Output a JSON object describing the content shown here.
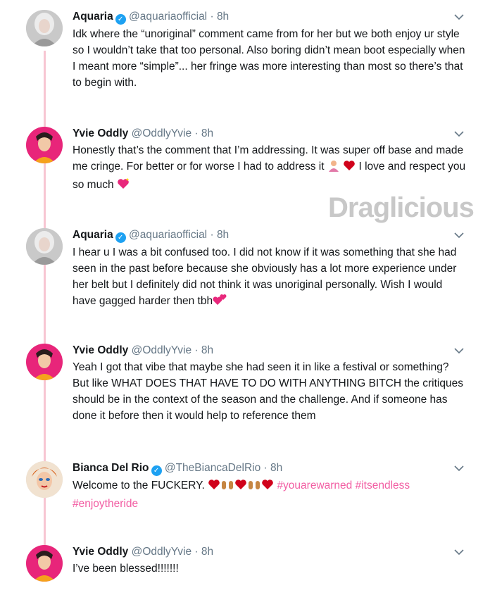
{
  "watermark": "Draglicious",
  "tweets": [
    {
      "name": "Aquaria",
      "verified": true,
      "handle": "@aquariaofficial",
      "time": "8h",
      "text": "Idk where the “unoriginal” comment came from for her but we both enjoy ur style so I wouldn’t take that too personal. Also boring didn’t mean boot especially when I meant more “simple”... her fringe was more interesting than most so there’s that to begin with."
    },
    {
      "name": "Yvie Oddly",
      "verified": false,
      "handle": "@OddlyYvie",
      "time": "8h",
      "text_a": "Honestly that’s the comment that I’m addressing. It was super off base and made me cringe. For better or for worse I had to address it",
      "text_b": "I love and respect you so much",
      "emojis": [
        "person-shrugging-emoji",
        "red-heart-emoji",
        "sparkling-heart-emoji"
      ]
    },
    {
      "name": "Aquaria",
      "verified": true,
      "handle": "@aquariaofficial",
      "time": "8h",
      "text": "I hear u I was a bit confused too. I did not know if it was something that she had seen in the past before because she obviously has a lot more experience under her belt but I definitely did not think it was unoriginal personally. Wish I would have gagged harder then tbh",
      "emojis": [
        "two-hearts-emoji"
      ]
    },
    {
      "name": "Yvie Oddly",
      "verified": false,
      "handle": "@OddlyYvie",
      "time": "8h",
      "text": "Yeah I got that vibe that maybe she had seen it in like a festival or something? But like WHAT DOES THAT HAVE TO DO WITH ANYTHING BITCH the critiques should be in the context of the season and the challenge. And if someone has done it before then it would help to reference them"
    },
    {
      "name": "Bianca Del Rio",
      "verified": true,
      "handle": "@TheBiancaDelRio",
      "time": "8h",
      "text": "Welcome to the FUCKERY.",
      "hashtags": [
        "#youarewarned",
        "#itsendless",
        "#enjoytheride"
      ],
      "emojis": [
        "red-heart-emoji",
        "raising-hands-emoji",
        "red-heart-emoji",
        "raising-hands-emoji",
        "red-heart-emoji"
      ]
    },
    {
      "name": "Yvie Oddly",
      "verified": false,
      "handle": "@OddlyYvie",
      "time": "8h",
      "text": "I’ve been blessed!!!!!!!"
    }
  ],
  "colors": {
    "thread_line": "#f7c6d2",
    "hashtag": "#f25ea3",
    "verified": "#1da1f2",
    "muted": "#657786"
  }
}
